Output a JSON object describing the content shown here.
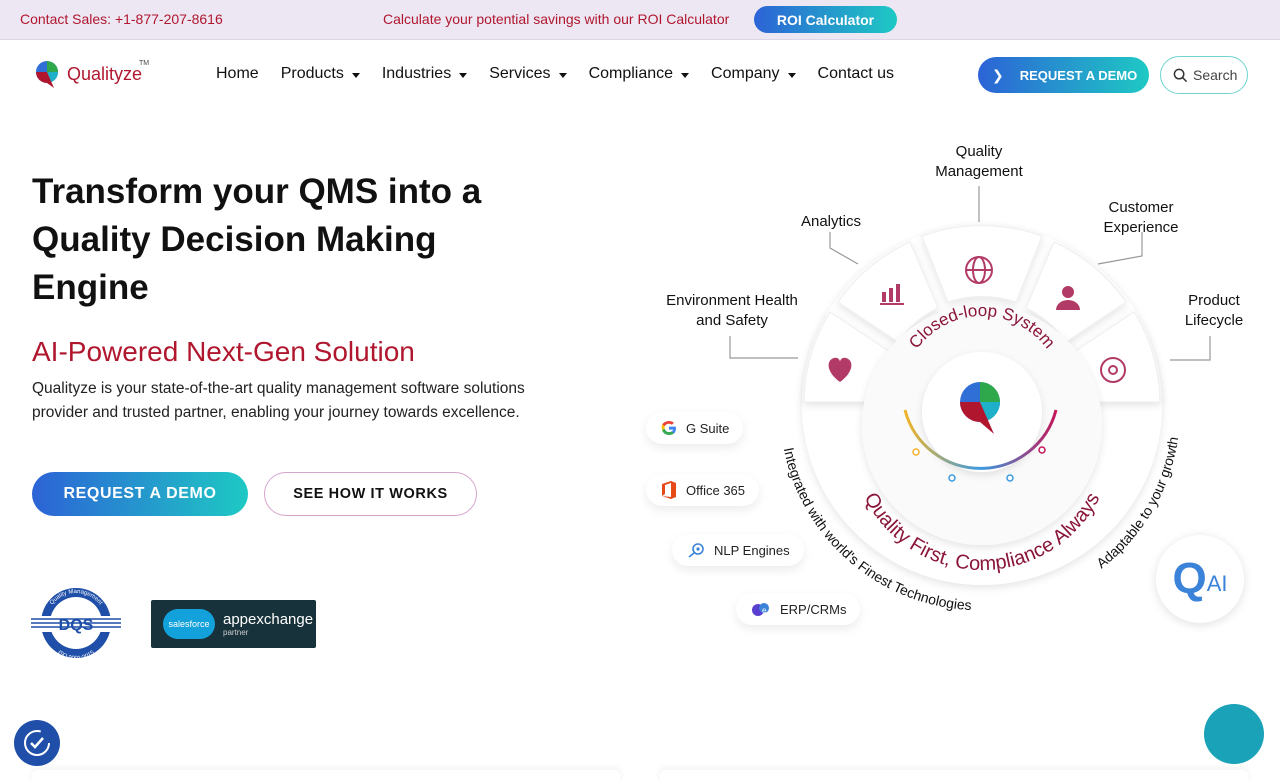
{
  "topbar": {
    "sales": "Contact Sales: +1-877-207-8616",
    "roi_text": "Calculate your potential savings with our ROI Calculator",
    "roi_button": "ROI Calculator"
  },
  "header": {
    "logo_text": "Qualityze",
    "logo_tm": "TM",
    "nav": [
      {
        "label": "Home",
        "dropdown": false
      },
      {
        "label": "Products",
        "dropdown": true
      },
      {
        "label": "Industries",
        "dropdown": true
      },
      {
        "label": "Services",
        "dropdown": true
      },
      {
        "label": "Compliance",
        "dropdown": true
      },
      {
        "label": "Company",
        "dropdown": true
      },
      {
        "label": "Contact us",
        "dropdown": false
      }
    ],
    "request_demo": "REQUEST A DEMO",
    "search": "Search"
  },
  "hero": {
    "title": "Transform your QMS into a Quality Decision Making Engine",
    "subtitle": "AI-Powered Next-Gen Solution",
    "description": "Qualityze is your state-of-the-art quality management software solutions provider and trusted partner, enabling your journey towards excellence.",
    "primary_button": "REQUEST A DEMO",
    "secondary_button": "SEE HOW IT WORKS"
  },
  "badges": {
    "iso_top": "Quality Management",
    "iso_mid": "DQS",
    "iso_bottom": "ISO 9001:2015",
    "salesforce_logo": "salesforce",
    "salesforce_main": "appexchange",
    "salesforce_sub": "partner"
  },
  "diagram": {
    "labels": {
      "quality_management": "Quality Management",
      "analytics": "Analytics",
      "customer_experience": "Customer Experience",
      "ehs": "Environment Health and Safety",
      "product_lifecycle": "Product Lifecycle"
    },
    "ring_top": "Closed-loop System",
    "ring_bottom": "Quality First, Compliance Always",
    "arc_left": "Integrated with world's Finest Technologies",
    "arc_right": "Adaptable to your growth",
    "integrations": [
      "G Suite",
      "Office 365",
      "NLP Engines",
      "ERP/CRMs"
    ],
    "qai_q": "Q",
    "qai_ai": "AI"
  },
  "colors": {
    "brand_red": "#b0172f",
    "gradient_start": "#2c63d6",
    "gradient_end": "#1ec9c4",
    "diagram_icon": "#b23a66"
  }
}
